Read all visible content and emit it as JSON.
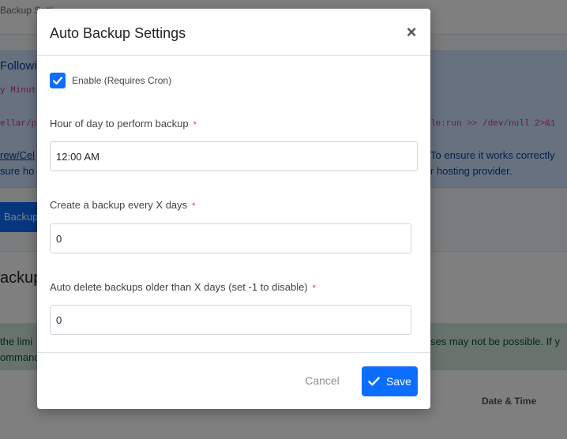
{
  "background": {
    "tab_label": "Backup Setti",
    "info_title": "Followi",
    "info_code_line1": "y Minut",
    "info_code_line2": "ellar/p",
    "info_code_line3": "le:run >> /dev/null 2>&1",
    "info_link": "rew/Cel",
    "info_text_line1": "sure ho",
    "info_text_right1": "To ensure it works correctly",
    "info_text_right2": "r hosting provider.",
    "backup_button": "Backup",
    "card_heading": "ackup",
    "alert_line1": "the limi",
    "alert_line2": "ommand",
    "alert_right": "ses may not be possible. If y",
    "table_header_date": "Date & Time"
  },
  "modal": {
    "title": "Auto Backup Settings",
    "close_symbol": "×",
    "enable_label": "Enable (Requires Cron)",
    "enable_checked": true,
    "hour_label": "Hour of day to perform backup",
    "hour_value": "12:00 AM",
    "days_label": "Create a backup every X days",
    "days_value": "0",
    "delete_label": "Auto delete backups older than X days (set -1 to disable)",
    "delete_value": "0",
    "required_marker": "*",
    "cancel_label": "Cancel",
    "save_label": "Save",
    "save_icon": "check-icon"
  },
  "colors": {
    "primary": "#0d6efd",
    "required": "#dc3545",
    "overlay": "rgba(0,0,0,0.5)"
  }
}
